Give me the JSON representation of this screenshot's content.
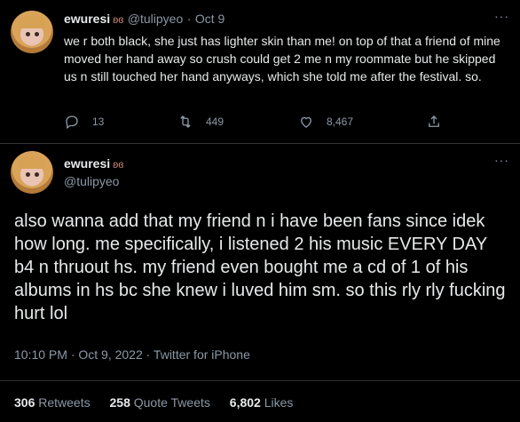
{
  "tweet1": {
    "display_name": "ewuresi",
    "badge_icon": "hands-heart-icon",
    "handle": "@tulipyeo",
    "separator": "·",
    "date": "Oct 9",
    "text": "we r both black, she just has lighter skin than me! on top of that a friend of mine moved her hand away so crush could get 2 me n my roommate but he skipped us n still touched her hand anyways, which she told me after the festival. so.",
    "more": "···",
    "replies": "13",
    "retweets": "449",
    "likes": "8,467"
  },
  "tweet2": {
    "display_name": "ewuresi",
    "badge_icon": "hands-heart-icon",
    "handle": "@tulipyeo",
    "more": "···",
    "text": "also wanna add that my friend n i have been fans since idek how long. me specifically, i listened 2 his music EVERY DAY b4 n thruout hs. my friend even bought me a cd of 1 of his albums in hs bc she knew i luved him sm. so this rly rly fucking hurt lol",
    "timestamp": "10:10 PM · Oct 9, 2022 · Twitter for iPhone",
    "retweets_count": "306",
    "retweets_label": "Retweets",
    "quote_count": "258",
    "quote_label": "Quote Tweets",
    "likes_count": "6,802",
    "likes_label": "Likes"
  },
  "colors": {
    "background": "#000000",
    "text_primary": "#e7e9ea",
    "text_secondary": "#8b98a5",
    "divider": "#2f3336"
  }
}
